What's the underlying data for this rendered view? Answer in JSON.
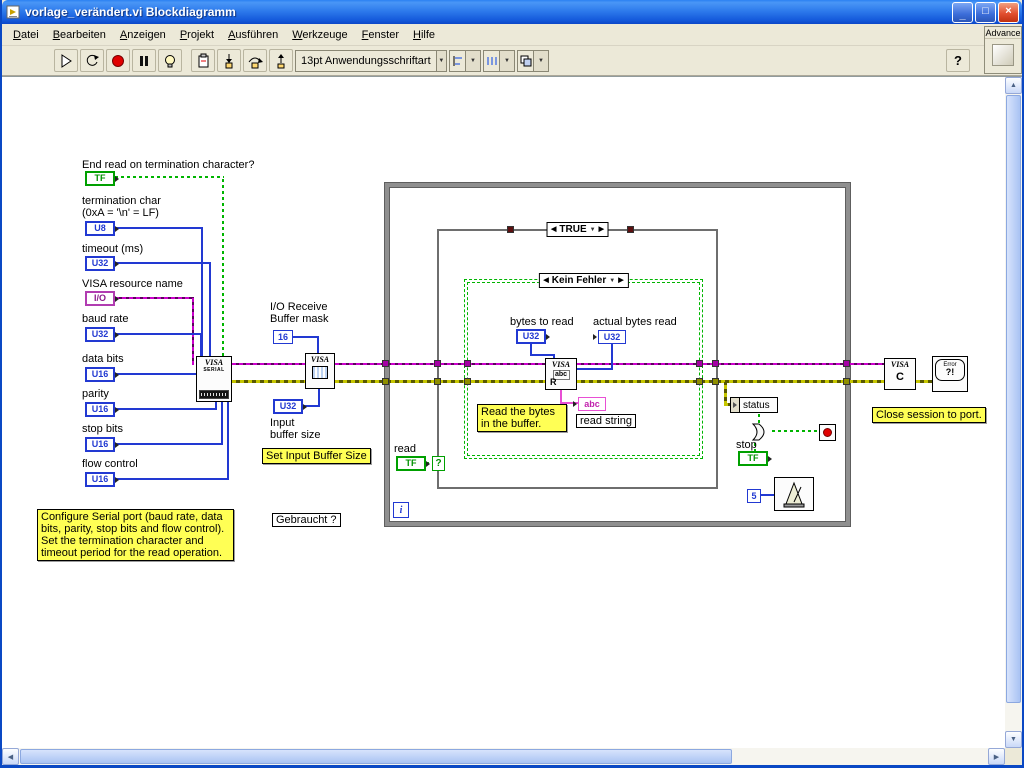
{
  "window": {
    "title": "vorlage_verändert.vi Blockdiagramm"
  },
  "menu": {
    "items": [
      "Datei",
      "Bearbeiten",
      "Anzeigen",
      "Projekt",
      "Ausführen",
      "Werkzeuge",
      "Fenster",
      "Hilfe"
    ]
  },
  "toolbar": {
    "font_selector": "13pt Anwendungsschriftart"
  },
  "palette": {
    "title": "Advance"
  },
  "icons": {
    "minimize": "_",
    "maximize": "□",
    "close": "×",
    "dropdown": "▼",
    "case_prev": "◀",
    "case_next": "▶",
    "help": "?"
  },
  "types": {
    "tf": "TF",
    "u8": "U8",
    "u16": "U16",
    "u32": "U32",
    "io": "I/O",
    "abc": "abc",
    "i": "i",
    "question": "?"
  },
  "controls": {
    "end_read": {
      "label": "End read on termination character?"
    },
    "termination": {
      "label1": "termination char",
      "label2": "(0xA = '\\n' = LF)"
    },
    "timeout": {
      "label": "timeout (ms)"
    },
    "visa_resource": {
      "label": "VISA resource name"
    },
    "baud": {
      "label": "baud rate"
    },
    "data_bits": {
      "label": "data bits"
    },
    "parity": {
      "label": "parity"
    },
    "stop_bits": {
      "label": "stop bits"
    },
    "flow": {
      "label": "flow control"
    }
  },
  "mid": {
    "io_receive_label1": "I/O Receive",
    "io_receive_label2": "Buffer mask",
    "buffer_mask_value": "16",
    "input_buffer_label1": "Input",
    "input_buffer_label2": "buffer size",
    "set_input_buffer": "Set Input Buffer Size",
    "gebraucht": "Gebraucht ?"
  },
  "loop": {
    "case_true": "TRUE",
    "case_no_error": "Kein Fehler",
    "bytes_to_read": "bytes to read",
    "actual_bytes_read": "actual bytes read",
    "read_note": "Read the bytes in the buffer.",
    "read_string": "read string",
    "read": "read",
    "status": "status",
    "stop": "stop"
  },
  "nodes": {
    "visa_serial": {
      "line1": "VISA",
      "line2": "SERIAL"
    },
    "visa_buffer": {
      "line1": "VISA"
    },
    "visa_read": {
      "line1": "VISA",
      "line2": "abc",
      "line3": "R"
    },
    "visa_close": {
      "line1": "VISA",
      "line2": "C"
    },
    "error_handler": {
      "line1": "Error",
      "line2": "?!"
    },
    "wait": {
      "value": "5"
    }
  },
  "notes": {
    "configure": "Configure Serial port (baud rate, data bits, parity, stop bits and flow control). Set the termination character and timeout period for the read operation.",
    "close": "Close session to port."
  }
}
